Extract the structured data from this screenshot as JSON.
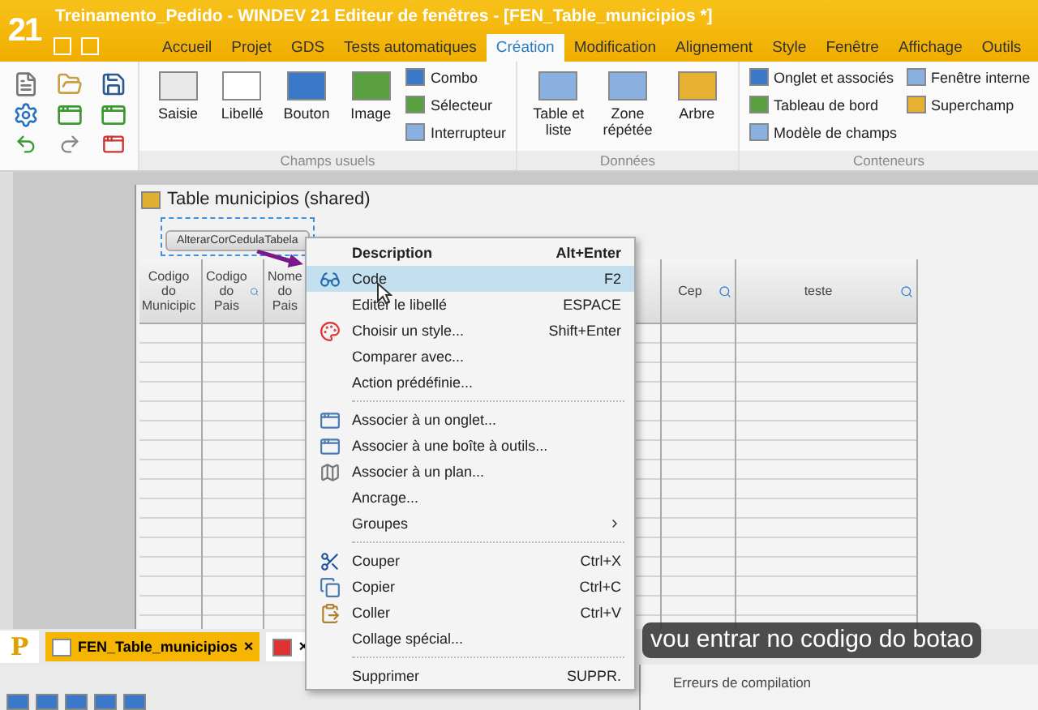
{
  "window": {
    "title": "Treinamento_Pedido - WINDEV 21  Editeur de fenêtres - [FEN_Table_municipios *]",
    "logo": "21"
  },
  "ribbon_tabs": [
    {
      "label": "Accueil",
      "selected": false
    },
    {
      "label": "Projet",
      "selected": false
    },
    {
      "label": "GDS",
      "selected": false
    },
    {
      "label": "Tests automatiques",
      "selected": false
    },
    {
      "label": "Création",
      "selected": true
    },
    {
      "label": "Modification",
      "selected": false
    },
    {
      "label": "Alignement",
      "selected": false
    },
    {
      "label": "Style",
      "selected": false
    },
    {
      "label": "Fenêtre",
      "selected": false
    },
    {
      "label": "Affichage",
      "selected": false
    },
    {
      "label": "Outils",
      "selected": false
    }
  ],
  "ribbon_groups": [
    {
      "title": "Champs usuels",
      "large": [
        "Saisie",
        "Libellé",
        "Bouton",
        "Image"
      ],
      "small": [
        "Combo",
        "Sélecteur",
        "Interrupteur"
      ]
    },
    {
      "title": "Données",
      "large": [
        "Table et liste",
        "Zone répétée",
        "Arbre"
      ]
    },
    {
      "title": "Conteneurs",
      "small": [
        "Onglet et associés",
        "Tableau de bord",
        "Modèle de champs",
        "Fenêtre interne",
        "Superchamp"
      ]
    }
  ],
  "editor_window": {
    "title": "Table municipios (shared)",
    "button": "AlterarCorCedulaTabela",
    "columns": [
      {
        "label": "Codigo do Municipic"
      },
      {
        "label": "Codigo do Pais"
      },
      {
        "label": "Nome do Pais"
      },
      {
        "label": "Cep"
      },
      {
        "label": "teste"
      }
    ]
  },
  "context_menu": [
    {
      "kind": "item",
      "label": "Description",
      "shortcut": "Alt+Enter",
      "selected": false
    },
    {
      "kind": "item",
      "label": "Code",
      "shortcut": "F2",
      "selected": true
    },
    {
      "kind": "item",
      "label": "Editer le libellé",
      "shortcut": "ESPACE",
      "selected": false
    },
    {
      "kind": "item",
      "label": "Choisir un style...",
      "shortcut": "Shift+Enter",
      "selected": false
    },
    {
      "kind": "item",
      "label": "Comparer avec...",
      "selected": false
    },
    {
      "kind": "item",
      "label": "Action prédéfinie...",
      "selected": false
    },
    {
      "kind": "separator"
    },
    {
      "kind": "item",
      "label": "Associer à un onglet...",
      "selected": false
    },
    {
      "kind": "item",
      "label": "Associer à une boîte à outils...",
      "selected": false
    },
    {
      "kind": "item",
      "label": "Associer à un plan...",
      "selected": false
    },
    {
      "kind": "item",
      "label": "Ancrage...",
      "selected": false
    },
    {
      "kind": "submenu",
      "label": "Groupes",
      "selected": false
    },
    {
      "kind": "separator"
    },
    {
      "kind": "item",
      "label": "Couper",
      "shortcut": "Ctrl+X",
      "selected": false
    },
    {
      "kind": "item",
      "label": "Copier",
      "shortcut": "Ctrl+C",
      "selected": false
    },
    {
      "kind": "item",
      "label": "Coller",
      "shortcut": "Ctrl+V",
      "selected": false
    },
    {
      "kind": "item",
      "label": "Collage spécial...",
      "selected": false
    },
    {
      "kind": "separator"
    },
    {
      "kind": "item",
      "label": "Supprimer",
      "shortcut": "SUPPR.",
      "selected": false
    }
  ],
  "document_tabs": [
    {
      "label": "FEN_Table_municipios",
      "close": "×",
      "selected": true
    },
    {
      "close": "×",
      "selected": false
    }
  ],
  "project_logo": "P",
  "bottom_pane": {
    "title": "Erreurs de compilation"
  },
  "subtitle": "vou entrar no codigo do botao"
}
